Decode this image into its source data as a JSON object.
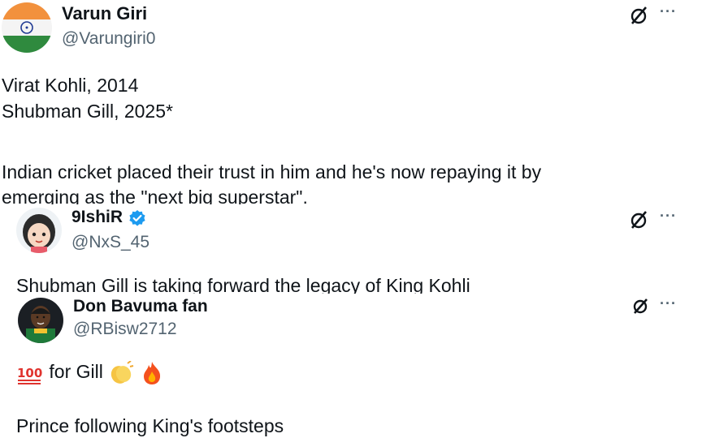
{
  "tweets": [
    {
      "name": "Varun Giri",
      "handle": "@Varungiri0",
      "lines": [
        "Virat Kohli, 2014",
        "Shubman Gill, 2025*",
        "",
        "Indian cricket placed their trust in him and he's now repaying it by",
        "emerging as the \"next big superstar\"."
      ]
    },
    {
      "name": "9IshiR",
      "handle": "@NxS_45",
      "verified": true,
      "lines": [
        "Shubman Gill is taking forward the legacy of King Kohli"
      ]
    },
    {
      "name": "Don Bavuma fan",
      "handle": "@RBisw2712",
      "lines": [
        "💯 for Gill 👏🔥",
        "",
        "Prince following King's footsteps"
      ],
      "line1_text": "for Gill"
    }
  ],
  "icons": {
    "grok": "grok-icon",
    "more": "more-options-icon",
    "more_glyph": "···",
    "verified_color": "#1d9bf0",
    "hundred": "hundred-points-emoji",
    "clap": "clapping-hands-emoji",
    "fire": "fire-emoji"
  }
}
